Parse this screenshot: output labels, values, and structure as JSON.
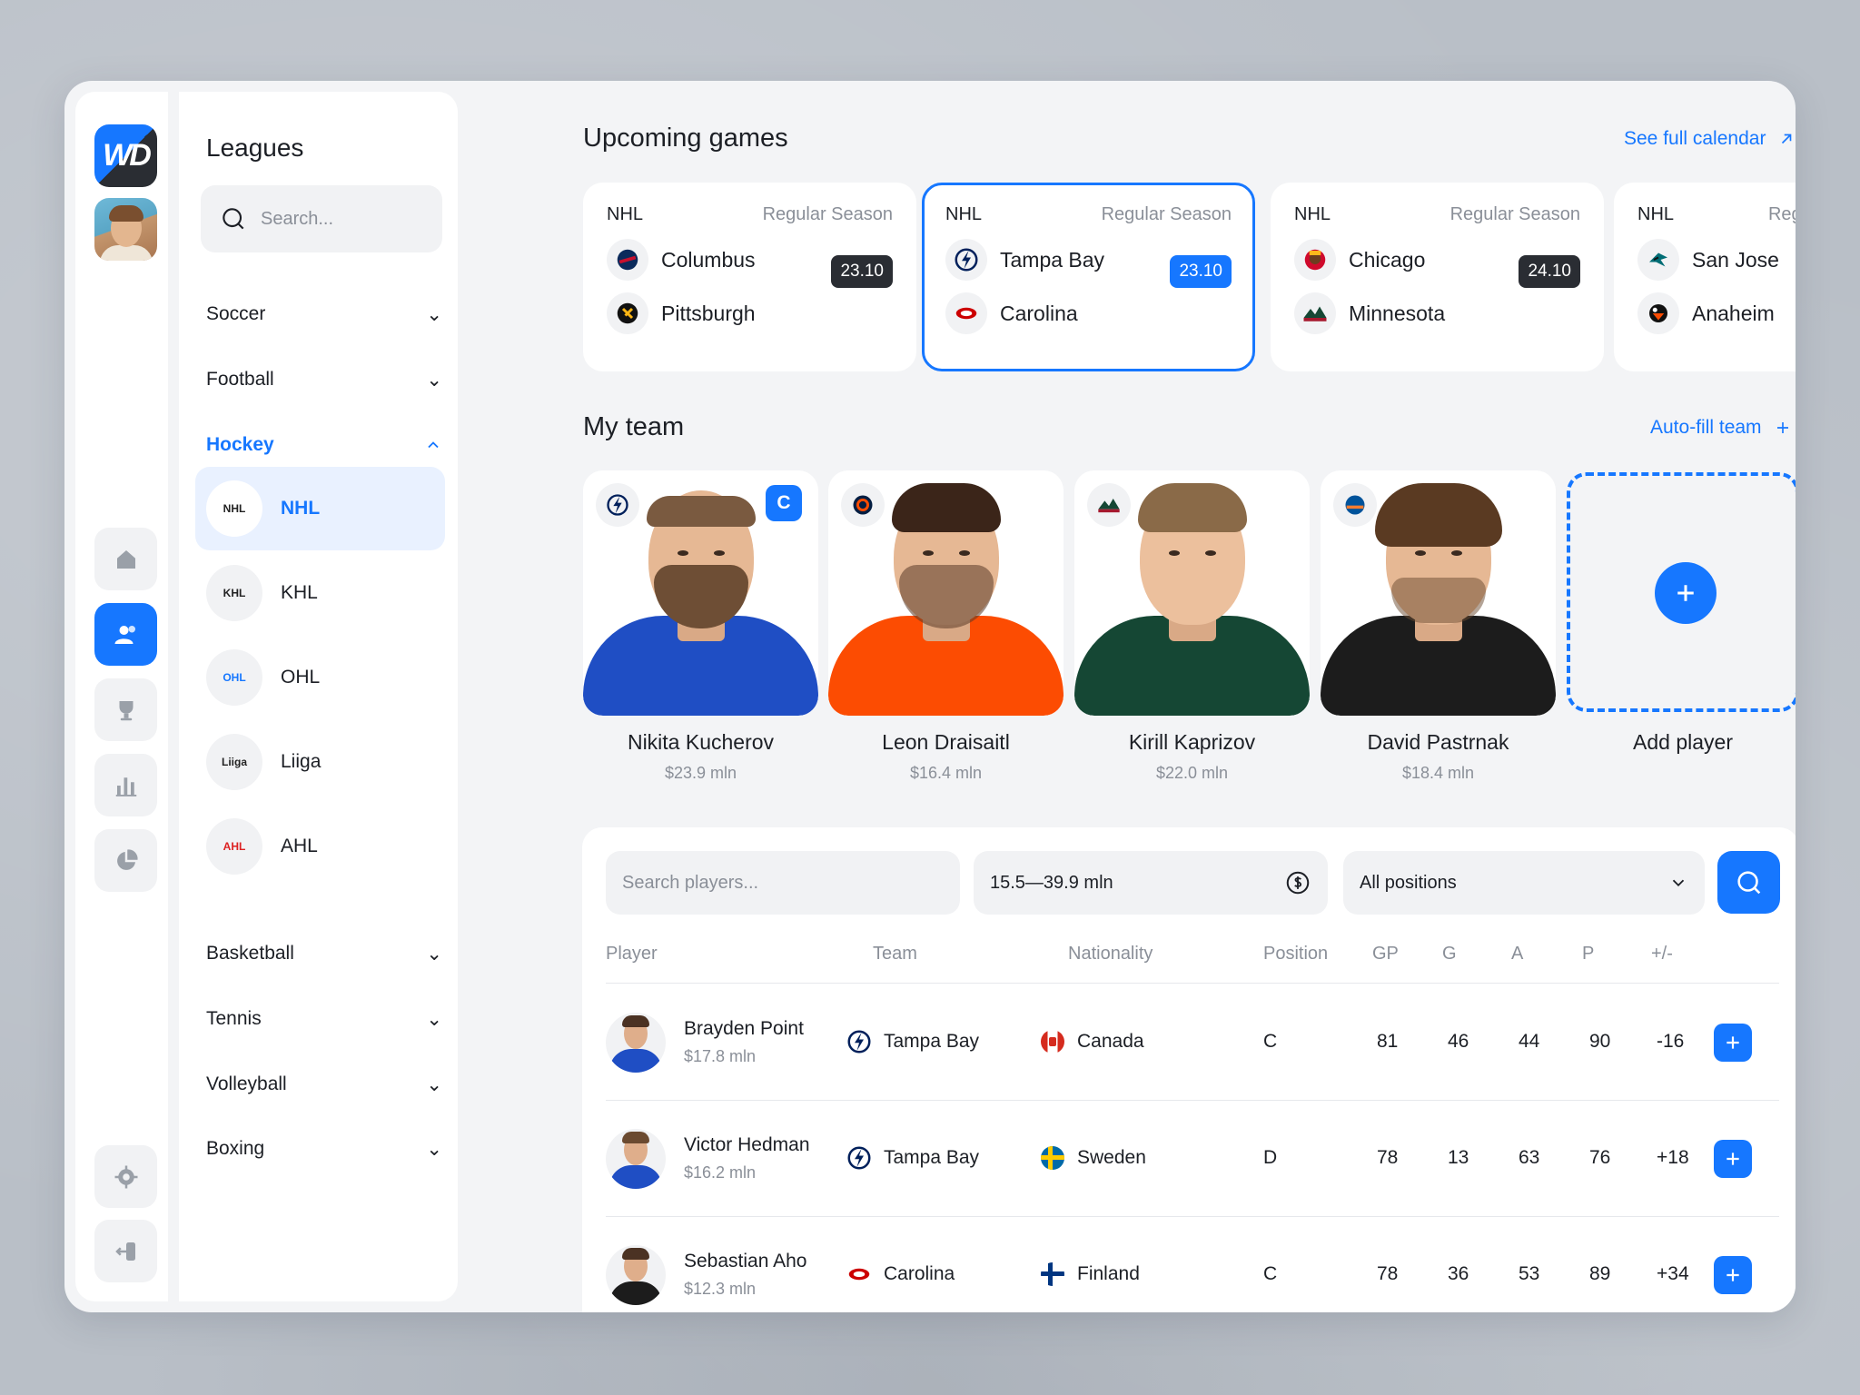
{
  "app": {
    "logo_text": "WD"
  },
  "rail": {
    "items": [
      {
        "icon": "home-icon"
      },
      {
        "icon": "users-icon",
        "active": true
      },
      {
        "icon": "trophy-icon"
      },
      {
        "icon": "bar-chart-icon"
      },
      {
        "icon": "pie-chart-icon"
      }
    ],
    "bottom": [
      {
        "icon": "gear-icon"
      },
      {
        "icon": "logout-icon"
      }
    ]
  },
  "leagues_panel": {
    "title": "Leagues",
    "search_placeholder": "Search...",
    "sports": {
      "soccer": "Soccer",
      "football": "Football",
      "hockey": "Hockey",
      "basketball": "Basketball",
      "tennis": "Tennis",
      "volleyball": "Volleyball",
      "boxing": "Boxing"
    },
    "hockey_leagues": [
      "NHL",
      "KHL",
      "OHL",
      "Liiga",
      "AHL"
    ],
    "league_logo_text": [
      "NHL",
      "KHL",
      "OHL",
      "Liiga",
      "AHL"
    ]
  },
  "upcoming": {
    "title": "Upcoming games",
    "link": "See full calendar",
    "games": [
      {
        "league": "NHL",
        "season": "Regular Season",
        "home": "Columbus",
        "away": "Pittsburgh",
        "date": "23.10"
      },
      {
        "league": "NHL",
        "season": "Regular Season",
        "home": "Tampa Bay",
        "away": "Carolina",
        "date": "23.10"
      },
      {
        "league": "NHL",
        "season": "Regular Season",
        "home": "Chicago",
        "away": "Minnesota",
        "date": "24.10"
      },
      {
        "league": "NHL",
        "season": "Regular",
        "home": "San Jose",
        "away": "Anaheim",
        "date": ""
      }
    ]
  },
  "my_team": {
    "title": "My team",
    "link": "Auto-fill team",
    "captain_badge": "C",
    "players": [
      {
        "name": "Nikita Kucherov",
        "price": "$23.9 mln"
      },
      {
        "name": "Leon Draisaitl",
        "price": "$16.4 mln"
      },
      {
        "name": "Kirill Kaprizov",
        "price": "$22.0 mln"
      },
      {
        "name": "David Pastrnak",
        "price": "$18.4 mln"
      }
    ],
    "add_label": "Add player"
  },
  "filters": {
    "search_placeholder": "Search players...",
    "price_range": "15.5—39.9 mln",
    "position": "All positions"
  },
  "table": {
    "headers": [
      "Player",
      "Team",
      "Nationality",
      "Position",
      "GP",
      "G",
      "A",
      "P",
      "+/-"
    ],
    "rows": [
      {
        "name": "Brayden Point",
        "price": "$17.8 mln",
        "team": "Tampa Bay",
        "nationality": "Canada",
        "position": "C",
        "gp": "81",
        "g": "46",
        "a": "44",
        "p": "90",
        "pm": "-16"
      },
      {
        "name": "Victor Hedman",
        "price": "$16.2 mln",
        "team": "Tampa Bay",
        "nationality": "Sweden",
        "position": "D",
        "gp": "78",
        "g": "13",
        "a": "63",
        "p": "76",
        "pm": "+18"
      },
      {
        "name": "Sebastian Aho",
        "price": "$12.3 mln",
        "team": "Carolina",
        "nationality": "Finland",
        "position": "C",
        "gp": "78",
        "g": "36",
        "a": "53",
        "p": "89",
        "pm": "+34"
      }
    ]
  },
  "colors": {
    "accent": "#1677ff",
    "dark": "#2a2d33",
    "muted": "#8a8f98",
    "panel": "#f3f4f6"
  }
}
